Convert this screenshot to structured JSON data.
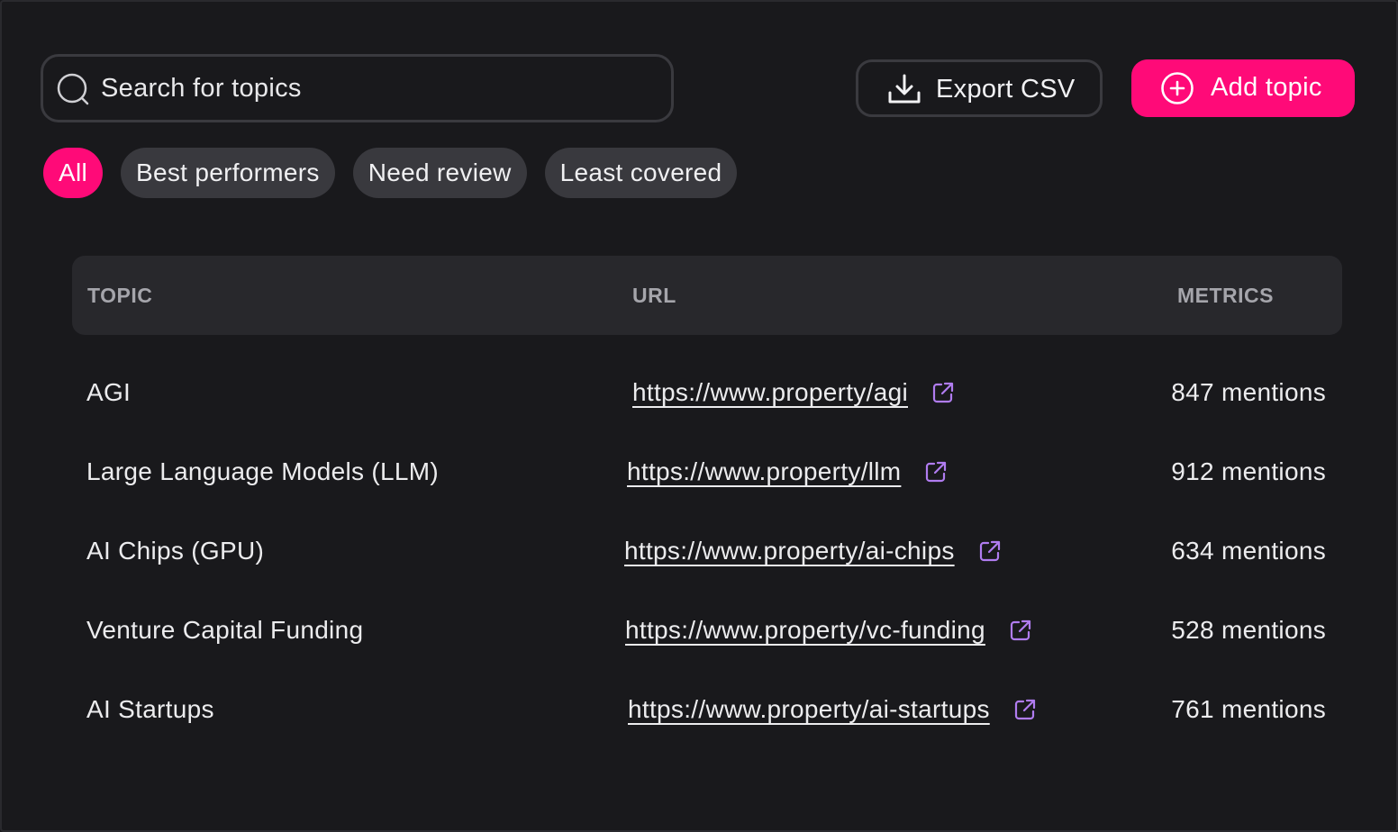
{
  "search": {
    "placeholder": "Search for topics",
    "value": ""
  },
  "actions": {
    "export_label": "Export CSV",
    "add_label": "Add topic"
  },
  "filters": [
    {
      "label": "All",
      "active": true
    },
    {
      "label": "Best performers",
      "active": false
    },
    {
      "label": "Need review",
      "active": false
    },
    {
      "label": "Least covered",
      "active": false
    }
  ],
  "table": {
    "headers": {
      "topic": "TOPIC",
      "url": "URL",
      "metrics": "METRICS"
    },
    "rows": [
      {
        "topic": "AGI",
        "url": "https://www.property/agi",
        "metrics": "847 mentions"
      },
      {
        "topic": "Large Language Models (LLM)",
        "url": "https://www.property/llm",
        "metrics": "912 mentions"
      },
      {
        "topic": "AI Chips (GPU)",
        "url": "https://www.property/ai-chips",
        "metrics": "634 mentions"
      },
      {
        "topic": "Venture Capital Funding",
        "url": "https://www.property/vc-funding",
        "metrics": "528 mentions"
      },
      {
        "topic": "AI Startups",
        "url": "https://www.property/ai-startups",
        "metrics": "761 mentions"
      }
    ]
  },
  "colors": {
    "accent": "#ff0a78",
    "link_icon": "#b07cf0",
    "background": "#19191c"
  },
  "icons": {
    "search": "search-icon",
    "export": "download-icon",
    "add": "plus-circle-icon",
    "link": "external-link-icon"
  }
}
